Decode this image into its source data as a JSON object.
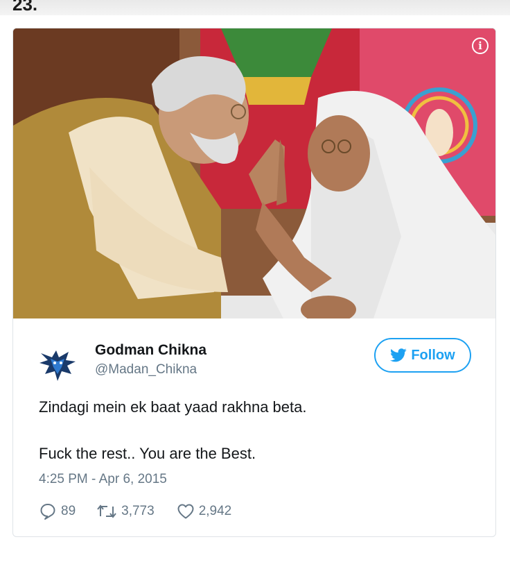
{
  "list_number": "23.",
  "colors": {
    "twitter_blue": "#1da1f2",
    "text_primary": "#14171a",
    "text_secondary": "#657786"
  },
  "tweet": {
    "display_name": "Godman Chikna",
    "handle": "@Madan_Chikna",
    "follow_label": "Follow",
    "text_line1": "Zindagi mein ek baat yaad rakhna beta.",
    "text_line2": "Fuck the rest.. You are the Best.",
    "timestamp": "4:25 PM - Apr 6, 2015",
    "replies": "89",
    "retweets": "3,773",
    "likes": "2,942",
    "avatar_icon": "wolf-head-icon",
    "media_info_icon": "info-icon"
  }
}
